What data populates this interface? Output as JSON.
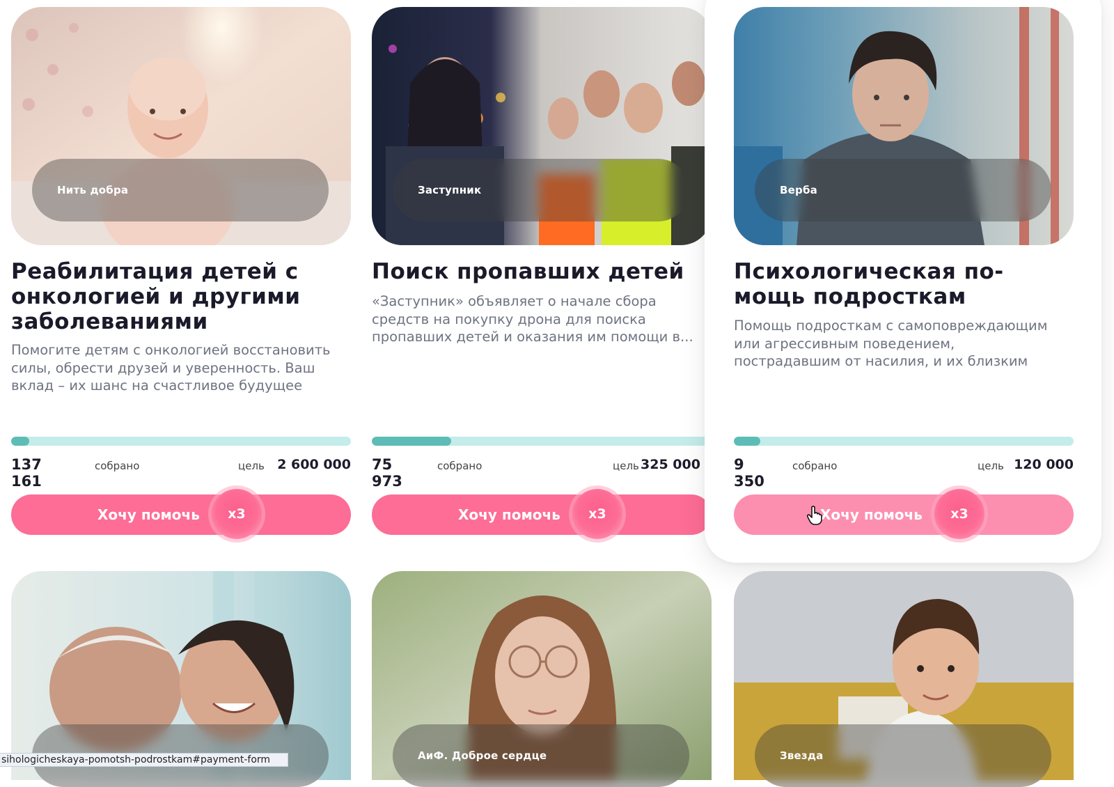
{
  "cards": [
    {
      "org": "Нить добра",
      "title": "Реабилитация детей с\nонкологией и другими\nзаболеваниями",
      "description": "Помогите детям с онкологией восстановить\nсилы, обрести друзей и уверенность. Ваш\nвклад – их шанс на счастливое будущее",
      "collected": "137 161",
      "collected_label": "собрано",
      "goal_label": "цель",
      "goal": "2 600 000",
      "progress": 0.053,
      "button_label": "Хочу помочь",
      "multiplier": "х3"
    },
    {
      "org": "Заступник",
      "title": "Поиск пропавших детей",
      "description": "«Заступник» объявляет о начале сбора\nсредств на покупку дрона для поиска\nпропавших детей и оказания им помощи в...",
      "collected": "75 973",
      "collected_label": "собрано",
      "goal_label": "цель",
      "goal": "325 000",
      "progress": 0.234,
      "button_label": "Хочу помочь",
      "multiplier": "х3"
    },
    {
      "org": "Верба",
      "title": "Психологическая по-\nмощь подросткам",
      "description": "Помощь подросткам с самоповреждающим\nили агрессивным поведением,\nпострадавшим от насилия, и их близким",
      "collected": "9 350",
      "collected_label": "собрано",
      "goal_label": "цель",
      "goal": "120 000",
      "progress": 0.078,
      "button_label": "Хочу помочь",
      "multiplier": "х3"
    },
    {
      "org": ""
    },
    {
      "org": "АиФ. Доброе сердце"
    },
    {
      "org": "Звезда"
    }
  ],
  "status_url": "sihologicheskaya-pomotsh-podrostkam#payment-form",
  "colors": {
    "button": "#fd6d96",
    "button_hover": "#fc8fb0",
    "progress_track": "#c4ecea",
    "progress_fill": "#5dbdb6"
  }
}
